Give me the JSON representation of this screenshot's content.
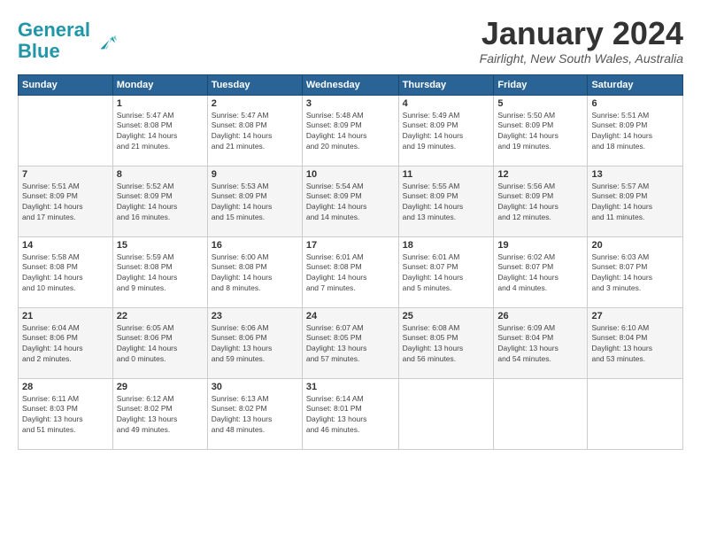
{
  "header": {
    "logo_general": "General",
    "logo_blue": "Blue",
    "title": "January 2024",
    "location": "Fairlight, New South Wales, Australia"
  },
  "days_of_week": [
    "Sunday",
    "Monday",
    "Tuesday",
    "Wednesday",
    "Thursday",
    "Friday",
    "Saturday"
  ],
  "weeks": [
    [
      {
        "num": "",
        "info": ""
      },
      {
        "num": "1",
        "info": "Sunrise: 5:47 AM\nSunset: 8:08 PM\nDaylight: 14 hours\nand 21 minutes."
      },
      {
        "num": "2",
        "info": "Sunrise: 5:47 AM\nSunset: 8:08 PM\nDaylight: 14 hours\nand 21 minutes."
      },
      {
        "num": "3",
        "info": "Sunrise: 5:48 AM\nSunset: 8:09 PM\nDaylight: 14 hours\nand 20 minutes."
      },
      {
        "num": "4",
        "info": "Sunrise: 5:49 AM\nSunset: 8:09 PM\nDaylight: 14 hours\nand 19 minutes."
      },
      {
        "num": "5",
        "info": "Sunrise: 5:50 AM\nSunset: 8:09 PM\nDaylight: 14 hours\nand 19 minutes."
      },
      {
        "num": "6",
        "info": "Sunrise: 5:51 AM\nSunset: 8:09 PM\nDaylight: 14 hours\nand 18 minutes."
      }
    ],
    [
      {
        "num": "7",
        "info": "Sunrise: 5:51 AM\nSunset: 8:09 PM\nDaylight: 14 hours\nand 17 minutes."
      },
      {
        "num": "8",
        "info": "Sunrise: 5:52 AM\nSunset: 8:09 PM\nDaylight: 14 hours\nand 16 minutes."
      },
      {
        "num": "9",
        "info": "Sunrise: 5:53 AM\nSunset: 8:09 PM\nDaylight: 14 hours\nand 15 minutes."
      },
      {
        "num": "10",
        "info": "Sunrise: 5:54 AM\nSunset: 8:09 PM\nDaylight: 14 hours\nand 14 minutes."
      },
      {
        "num": "11",
        "info": "Sunrise: 5:55 AM\nSunset: 8:09 PM\nDaylight: 14 hours\nand 13 minutes."
      },
      {
        "num": "12",
        "info": "Sunrise: 5:56 AM\nSunset: 8:09 PM\nDaylight: 14 hours\nand 12 minutes."
      },
      {
        "num": "13",
        "info": "Sunrise: 5:57 AM\nSunset: 8:09 PM\nDaylight: 14 hours\nand 11 minutes."
      }
    ],
    [
      {
        "num": "14",
        "info": "Sunrise: 5:58 AM\nSunset: 8:08 PM\nDaylight: 14 hours\nand 10 minutes."
      },
      {
        "num": "15",
        "info": "Sunrise: 5:59 AM\nSunset: 8:08 PM\nDaylight: 14 hours\nand 9 minutes."
      },
      {
        "num": "16",
        "info": "Sunrise: 6:00 AM\nSunset: 8:08 PM\nDaylight: 14 hours\nand 8 minutes."
      },
      {
        "num": "17",
        "info": "Sunrise: 6:01 AM\nSunset: 8:08 PM\nDaylight: 14 hours\nand 7 minutes."
      },
      {
        "num": "18",
        "info": "Sunrise: 6:01 AM\nSunset: 8:07 PM\nDaylight: 14 hours\nand 5 minutes."
      },
      {
        "num": "19",
        "info": "Sunrise: 6:02 AM\nSunset: 8:07 PM\nDaylight: 14 hours\nand 4 minutes."
      },
      {
        "num": "20",
        "info": "Sunrise: 6:03 AM\nSunset: 8:07 PM\nDaylight: 14 hours\nand 3 minutes."
      }
    ],
    [
      {
        "num": "21",
        "info": "Sunrise: 6:04 AM\nSunset: 8:06 PM\nDaylight: 14 hours\nand 2 minutes."
      },
      {
        "num": "22",
        "info": "Sunrise: 6:05 AM\nSunset: 8:06 PM\nDaylight: 14 hours\nand 0 minutes."
      },
      {
        "num": "23",
        "info": "Sunrise: 6:06 AM\nSunset: 8:06 PM\nDaylight: 13 hours\nand 59 minutes."
      },
      {
        "num": "24",
        "info": "Sunrise: 6:07 AM\nSunset: 8:05 PM\nDaylight: 13 hours\nand 57 minutes."
      },
      {
        "num": "25",
        "info": "Sunrise: 6:08 AM\nSunset: 8:05 PM\nDaylight: 13 hours\nand 56 minutes."
      },
      {
        "num": "26",
        "info": "Sunrise: 6:09 AM\nSunset: 8:04 PM\nDaylight: 13 hours\nand 54 minutes."
      },
      {
        "num": "27",
        "info": "Sunrise: 6:10 AM\nSunset: 8:04 PM\nDaylight: 13 hours\nand 53 minutes."
      }
    ],
    [
      {
        "num": "28",
        "info": "Sunrise: 6:11 AM\nSunset: 8:03 PM\nDaylight: 13 hours\nand 51 minutes."
      },
      {
        "num": "29",
        "info": "Sunrise: 6:12 AM\nSunset: 8:02 PM\nDaylight: 13 hours\nand 49 minutes."
      },
      {
        "num": "30",
        "info": "Sunrise: 6:13 AM\nSunset: 8:02 PM\nDaylight: 13 hours\nand 48 minutes."
      },
      {
        "num": "31",
        "info": "Sunrise: 6:14 AM\nSunset: 8:01 PM\nDaylight: 13 hours\nand 46 minutes."
      },
      {
        "num": "",
        "info": ""
      },
      {
        "num": "",
        "info": ""
      },
      {
        "num": "",
        "info": ""
      }
    ]
  ]
}
